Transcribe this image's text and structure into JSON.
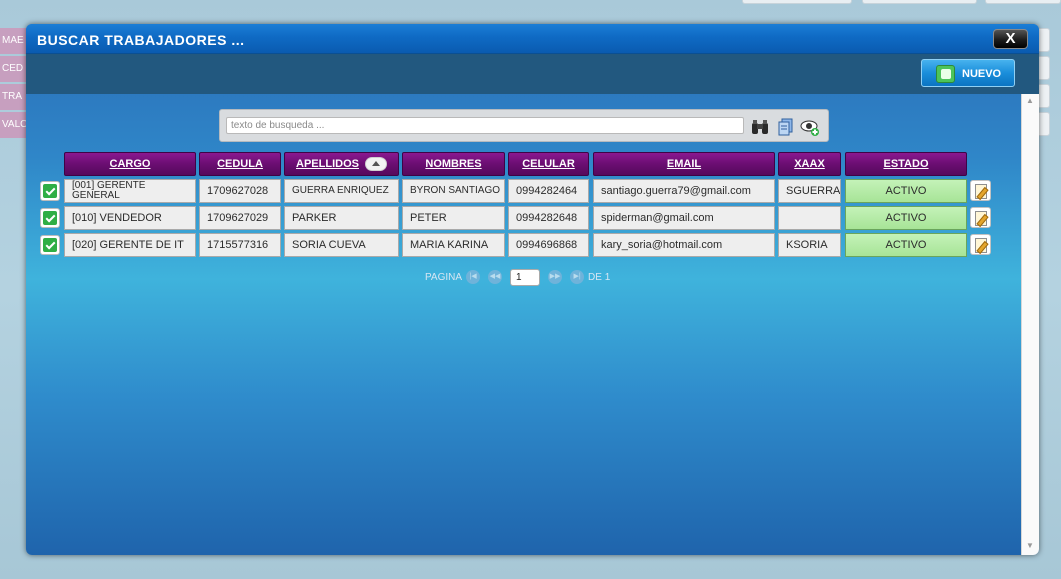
{
  "background": {
    "side_tabs": [
      "MAE",
      "CED",
      "TRA",
      "VALO"
    ]
  },
  "modal": {
    "title": "BUSCAR TRABAJADORES ...",
    "close_label": "X",
    "new_button_label": "NUEVO"
  },
  "search": {
    "placeholder": "texto de busqueda ...",
    "value": "",
    "icons": [
      "binoculars-icon",
      "copy-icon",
      "view-icon"
    ]
  },
  "table": {
    "columns": [
      "CARGO",
      "CEDULA",
      "APELLIDOS",
      "NOMBRES",
      "CELULAR",
      "EMAIL",
      "XAAX",
      "ESTADO"
    ],
    "sorted_column": "APELLIDOS",
    "rows": [
      {
        "checked": true,
        "cargo": "[001] GERENTE GENERAL",
        "cedula": "1709627028",
        "apellidos": "GUERRA ENRIQUEZ",
        "nombres": "BYRON SANTIAGO",
        "celular": "0994282464",
        "email": "santiago.guerra79@gmail.com",
        "xaax": "SGUERRA",
        "estado": "ACTIVO"
      },
      {
        "checked": true,
        "cargo": "[010] VENDEDOR",
        "cedula": "1709627029",
        "apellidos": "PARKER",
        "nombres": "PETER",
        "celular": "0994282648",
        "email": "spiderman@gmail.com",
        "xaax": "",
        "estado": "ACTIVO"
      },
      {
        "checked": true,
        "cargo": "[020] GERENTE DE IT",
        "cedula": "1715577316",
        "apellidos": "SORIA CUEVA",
        "nombres": "MARIA KARINA",
        "celular": "0994696868",
        "email": "kary_soria@hotmail.com",
        "xaax": "KSORIA",
        "estado": "ACTIVO"
      }
    ]
  },
  "pager": {
    "label": "PAGINA",
    "current": "1",
    "of_label": "DE 1"
  },
  "colors": {
    "header_purple": "#6b0e72",
    "status_green": "#a7e497",
    "title_blue": "#0f6ac4"
  }
}
